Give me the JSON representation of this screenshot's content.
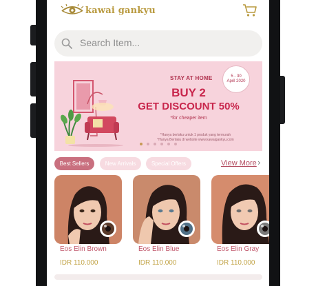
{
  "header": {
    "brand": "kawai gankyu",
    "cart_icon": "cart-icon",
    "logo_icon": "eye-logo-icon"
  },
  "search": {
    "placeholder": "Search Item...",
    "icon": "search-icon"
  },
  "banner": {
    "headline_small": "STAY AT HOME",
    "headline_1": "BUY 2",
    "headline_2": "GET DISCOUNT 50%",
    "subtext": "*for cheaper item",
    "date_line_1": "5 - 30",
    "date_line_2": "April 2020",
    "note_1": "*Hanya berlaku untuk 1 produk yang termurah",
    "note_2": "*Hanya Berlaku di website www.kawaigankyu.com",
    "slide_count": 6,
    "active_slide": 1,
    "colors": {
      "background": "#f7d3dc",
      "accent": "#c8264c"
    }
  },
  "tabs": [
    {
      "label": "Best Sellers",
      "active": true
    },
    {
      "label": "New Arrivals",
      "active": false
    },
    {
      "label": "Special Offers",
      "active": false
    }
  ],
  "view_more": {
    "label": "View More",
    "icon": "chevron-right-icon"
  },
  "products": [
    {
      "name": "Eos Elin Brown",
      "price": "IDR 110.000"
    },
    {
      "name": "Eos Elin Blue",
      "price": "IDR 110.000"
    },
    {
      "name": "Eos Elin Gray",
      "price": "IDR 110.000"
    }
  ]
}
